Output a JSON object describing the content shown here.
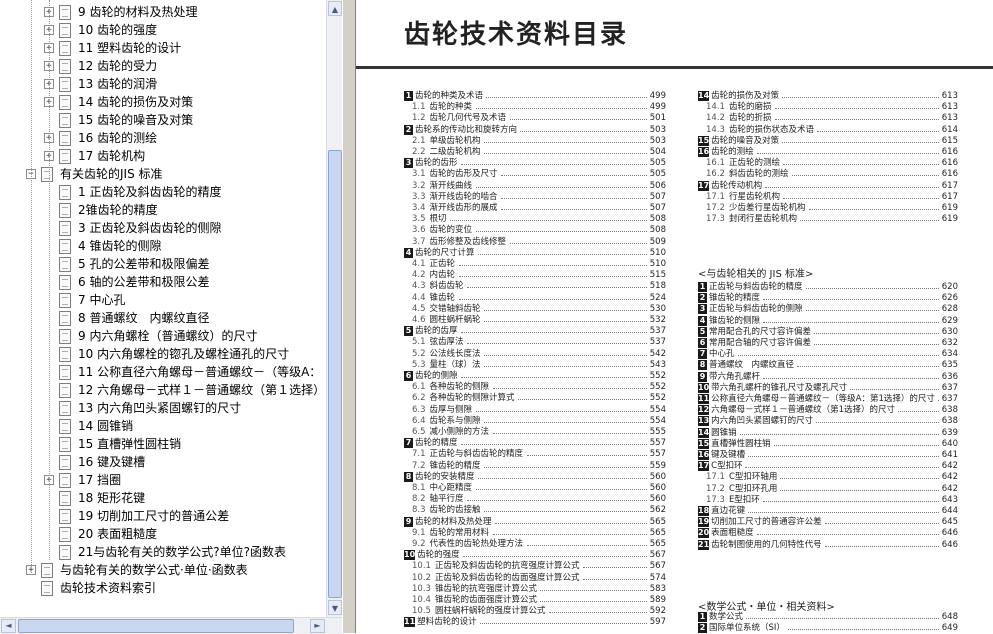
{
  "sidebar": {
    "tree": [
      {
        "indent": 1,
        "expander": "+",
        "label": "9 齿轮的材料及热处理"
      },
      {
        "indent": 1,
        "expander": "+",
        "label": "10 齿轮的强度"
      },
      {
        "indent": 1,
        "expander": "+",
        "label": "11 塑料齿轮的设计"
      },
      {
        "indent": 1,
        "expander": "+",
        "label": "12 齿轮的受力"
      },
      {
        "indent": 1,
        "expander": "+",
        "label": "13 齿轮的润滑"
      },
      {
        "indent": 1,
        "expander": "+",
        "label": "14 齿轮的损伤及对策"
      },
      {
        "indent": 1,
        "expander": "",
        "label": "15 齿轮的噪音及对策"
      },
      {
        "indent": 1,
        "expander": "+",
        "label": "16 齿轮的测绘"
      },
      {
        "indent": 1,
        "expander": "+",
        "label": "17 齿轮机构"
      },
      {
        "indent": 0,
        "expander": "−",
        "label": "有关齿轮的JIS 标准"
      },
      {
        "indent": 1,
        "expander": "",
        "label": "1 正齿轮及斜齿齿轮的精度"
      },
      {
        "indent": 1,
        "expander": "",
        "label": "2锥齿轮的精度"
      },
      {
        "indent": 1,
        "expander": "",
        "label": "3 正齿轮及斜齿齿轮的侧隙"
      },
      {
        "indent": 1,
        "expander": "",
        "label": "4 锥齿轮的侧隙"
      },
      {
        "indent": 1,
        "expander": "",
        "label": "5 孔的公差带和极限偏差"
      },
      {
        "indent": 1,
        "expander": "",
        "label": "6 轴的公差带和极限公差"
      },
      {
        "indent": 1,
        "expander": "",
        "label": "7 中心孔"
      },
      {
        "indent": 1,
        "expander": "",
        "label": "8 普通螺纹　内螺纹直径"
      },
      {
        "indent": 1,
        "expander": "",
        "label": "9 内六角螺栓（普通螺纹）的尺寸"
      },
      {
        "indent": 1,
        "expander": "",
        "label": "10 内六角螺栓的锪孔及螺栓通孔的尺寸"
      },
      {
        "indent": 1,
        "expander": "",
        "label": "11 公称直径六角螺母－普通螺纹－（等级A："
      },
      {
        "indent": 1,
        "expander": "",
        "label": "12 六角螺母－式样１－普通螺纹（第１选择）"
      },
      {
        "indent": 1,
        "expander": "",
        "label": "13 内六角凹头紧固螺钉的尺寸"
      },
      {
        "indent": 1,
        "expander": "",
        "label": "14 圆锥销"
      },
      {
        "indent": 1,
        "expander": "",
        "label": "15 直槽弹性圆柱销"
      },
      {
        "indent": 1,
        "expander": "",
        "label": "16 键及键槽"
      },
      {
        "indent": 1,
        "expander": "+",
        "label": "17 挡圈"
      },
      {
        "indent": 1,
        "expander": "",
        "label": "18 矩形花键"
      },
      {
        "indent": 1,
        "expander": "",
        "label": "19 切削加工尺寸的普通公差"
      },
      {
        "indent": 1,
        "expander": "",
        "label": "20 表面粗糙度"
      },
      {
        "indent": 1,
        "expander": "",
        "label": "21与齿轮有关的数学公式?单位?函数表"
      },
      {
        "indent": 0,
        "expander": "+",
        "label": "与齿轮有关的数学公式·单位·函数表"
      },
      {
        "indent": 0,
        "expander": "",
        "label": "齿轮技术资料索引"
      }
    ]
  },
  "scrollbars": {
    "up": "▲",
    "down": "▼",
    "left": "◄",
    "right": "►"
  },
  "document": {
    "title": "齿轮技术资料目录",
    "left_column": [
      {
        "type": "ch",
        "num": "1",
        "text": "齿轮的种类及术语",
        "page": "499"
      },
      {
        "type": "sub",
        "num": "1.1",
        "text": "齿轮的种类",
        "page": "499"
      },
      {
        "type": "sub",
        "num": "1.2",
        "text": "齿轮几何代号及术语",
        "page": "501"
      },
      {
        "type": "ch",
        "num": "2",
        "text": "齿轮系的传动比和旋转方向",
        "page": "503"
      },
      {
        "type": "sub",
        "num": "2.1",
        "text": "单级齿轮机构",
        "page": "503"
      },
      {
        "type": "sub",
        "num": "2.2",
        "text": "二级齿轮机构",
        "page": "504"
      },
      {
        "type": "ch",
        "num": "3",
        "text": "齿轮的齿形",
        "page": "505"
      },
      {
        "type": "sub",
        "num": "3.1",
        "text": "齿轮的齿形及尺寸",
        "page": "505"
      },
      {
        "type": "sub",
        "num": "3.2",
        "text": "渐开线曲线",
        "page": "506"
      },
      {
        "type": "sub",
        "num": "3.3",
        "text": "渐开线齿轮的啮合",
        "page": "507"
      },
      {
        "type": "sub",
        "num": "3.4",
        "text": "渐开线齿形的展成",
        "page": "507"
      },
      {
        "type": "sub",
        "num": "3.5",
        "text": "根切",
        "page": "508"
      },
      {
        "type": "sub",
        "num": "3.6",
        "text": "齿轮的变位",
        "page": "508"
      },
      {
        "type": "sub",
        "num": "3.7",
        "text": "齿形修整及齿线修整",
        "page": "509"
      },
      {
        "type": "ch",
        "num": "4",
        "text": "齿轮的尺寸计算",
        "page": "510"
      },
      {
        "type": "sub",
        "num": "4.1",
        "text": "正齿轮",
        "page": "510"
      },
      {
        "type": "sub",
        "num": "4.2",
        "text": "内齿轮",
        "page": "515"
      },
      {
        "type": "sub",
        "num": "4.3",
        "text": "斜齿齿轮",
        "page": "518"
      },
      {
        "type": "sub",
        "num": "4.4",
        "text": "锥齿轮",
        "page": "524"
      },
      {
        "type": "sub",
        "num": "4.5",
        "text": "交错轴斜齿轮",
        "page": "530"
      },
      {
        "type": "sub",
        "num": "4.6",
        "text": "圆柱蜗杆蜗轮",
        "page": "532"
      },
      {
        "type": "ch",
        "num": "5",
        "text": "齿轮的齿厚",
        "page": "537"
      },
      {
        "type": "sub",
        "num": "5.1",
        "text": "弦齿厚法",
        "page": "537"
      },
      {
        "type": "sub",
        "num": "5.2",
        "text": "公法线长度法",
        "page": "542"
      },
      {
        "type": "sub",
        "num": "5.3",
        "text": "量柱（球）法",
        "page": "543"
      },
      {
        "type": "ch",
        "num": "6",
        "text": "齿轮的侧隙",
        "page": "552"
      },
      {
        "type": "sub",
        "num": "6.1",
        "text": "各种齿轮的侧隙",
        "page": "552"
      },
      {
        "type": "sub",
        "num": "6.2",
        "text": "各种齿轮的侧隙计算式",
        "page": "552"
      },
      {
        "type": "sub",
        "num": "6.3",
        "text": "齿厚与侧隙",
        "page": "554"
      },
      {
        "type": "sub",
        "num": "6.4",
        "text": "齿轮系与侧隙",
        "page": "554"
      },
      {
        "type": "sub",
        "num": "6.5",
        "text": "减小侧隙的方法",
        "page": "555"
      },
      {
        "type": "ch",
        "num": "7",
        "text": "齿轮的精度",
        "page": "557"
      },
      {
        "type": "sub",
        "num": "7.1",
        "text": "正齿轮与斜齿齿轮的精度",
        "page": "557"
      },
      {
        "type": "sub",
        "num": "7.2",
        "text": "锥齿轮的精度",
        "page": "559"
      },
      {
        "type": "ch",
        "num": "8",
        "text": "齿轮的安装精度",
        "page": "560"
      },
      {
        "type": "sub",
        "num": "8.1",
        "text": "中心距精度",
        "page": "560"
      },
      {
        "type": "sub",
        "num": "8.2",
        "text": "轴平行度",
        "page": "560"
      },
      {
        "type": "sub",
        "num": "8.3",
        "text": "齿轮的齿接触",
        "page": "562"
      },
      {
        "type": "ch",
        "num": "9",
        "text": "齿轮的材料及热处理",
        "page": "565"
      },
      {
        "type": "sub",
        "num": "9.1",
        "text": "齿轮的常用材料",
        "page": "565"
      },
      {
        "type": "sub",
        "num": "9.2",
        "text": "代表性的齿轮热处理方法",
        "page": "565"
      },
      {
        "type": "ch",
        "num": "10",
        "text": "齿轮的强度",
        "page": "567"
      },
      {
        "type": "sub",
        "num": "10.1",
        "text": "正齿轮及斜齿齿轮的抗弯强度计算公式",
        "page": "567"
      },
      {
        "type": "sub",
        "num": "10.2",
        "text": "正齿轮及斜齿齿轮的齿面强度计算公式",
        "page": "574"
      },
      {
        "type": "sub",
        "num": "10.3",
        "text": "锥齿轮的抗弯强度计算公式",
        "page": "583"
      },
      {
        "type": "sub",
        "num": "10.4",
        "text": "锥齿轮的齿面强度计算公式",
        "page": "589"
      },
      {
        "type": "sub",
        "num": "10.5",
        "text": "圆柱蜗杆蜗轮的强度计算公式",
        "page": "592"
      },
      {
        "type": "ch",
        "num": "11",
        "text": "塑料齿轮的设计",
        "page": "597"
      }
    ],
    "right_column_top": [
      {
        "type": "ch",
        "num": "14",
        "text": "齿轮的损伤及对策",
        "page": "613"
      },
      {
        "type": "sub",
        "num": "14.1",
        "text": "齿轮的磨损",
        "page": "613"
      },
      {
        "type": "sub",
        "num": "14.2",
        "text": "齿轮的折损",
        "page": "613"
      },
      {
        "type": "sub",
        "num": "14.3",
        "text": "齿轮的损伤状态及术语",
        "page": "614"
      },
      {
        "type": "ch",
        "num": "15",
        "text": "齿轮的噪音及对策",
        "page": "615"
      },
      {
        "type": "ch",
        "num": "16",
        "text": "齿轮的测绘",
        "page": "616"
      },
      {
        "type": "sub",
        "num": "16.1",
        "text": "正齿轮的测绘",
        "page": "616"
      },
      {
        "type": "sub",
        "num": "16.2",
        "text": "斜齿齿轮的测绘",
        "page": "616"
      },
      {
        "type": "ch",
        "num": "17",
        "text": "齿轮传动机构",
        "page": "617"
      },
      {
        "type": "sub",
        "num": "17.1",
        "text": "行星齿轮机构",
        "page": "617"
      },
      {
        "type": "sub",
        "num": "17.2",
        "text": "少齿差行星齿轮机构",
        "page": "619"
      },
      {
        "type": "sub",
        "num": "17.3",
        "text": "封闭行星齿轮机构",
        "page": "619"
      }
    ],
    "jis_heading": "<与齿轮相关的 JIS 标准>",
    "jis_items": [
      {
        "type": "ch",
        "num": "1",
        "text": "正齿轮与斜齿齿轮的精度",
        "page": "620"
      },
      {
        "type": "ch",
        "num": "2",
        "text": "锥齿轮的精度",
        "page": "626"
      },
      {
        "type": "ch",
        "num": "3",
        "text": "正齿轮与斜齿齿轮的侧隙",
        "page": "628"
      },
      {
        "type": "ch",
        "num": "4",
        "text": "锥齿轮的侧隙",
        "page": "629"
      },
      {
        "type": "ch",
        "num": "5",
        "text": "常用配合孔的尺寸容许偏差",
        "page": "630"
      },
      {
        "type": "ch",
        "num": "6",
        "text": "常用配合轴的尺寸容许偏差",
        "page": "632"
      },
      {
        "type": "ch",
        "num": "7",
        "text": "中心孔",
        "page": "634"
      },
      {
        "type": "ch",
        "num": "8",
        "text": "普通螺纹　内螺纹直径",
        "page": "635"
      },
      {
        "type": "ch",
        "num": "9",
        "text": "带六角孔螺杆",
        "page": "636"
      },
      {
        "type": "ch",
        "num": "10",
        "text": "带六角孔螺杆的锥孔尺寸及螺孔尺寸",
        "page": "637"
      },
      {
        "type": "ch",
        "num": "11",
        "text": "公称直径六角螺母－普通螺纹－（等级A：第1选择）的尺寸",
        "page": "637"
      },
      {
        "type": "ch",
        "num": "12",
        "text": "六角螺母－式样１－普通螺纹（第1选择）的尺寸",
        "page": "638"
      },
      {
        "type": "ch",
        "num": "13",
        "text": "内六角凹头紧固螺钉的尺寸",
        "page": "638"
      },
      {
        "type": "ch",
        "num": "14",
        "text": "圆锥销",
        "page": "639"
      },
      {
        "type": "ch",
        "num": "15",
        "text": "直槽弹性圆柱销",
        "page": "640"
      },
      {
        "type": "ch",
        "num": "16",
        "text": "键及键槽",
        "page": "641"
      },
      {
        "type": "ch",
        "num": "17",
        "text": "C型扣环",
        "page": "642"
      },
      {
        "type": "sub",
        "num": "17.1",
        "text": "C型扣环轴用",
        "page": "642"
      },
      {
        "type": "sub",
        "num": "17.2",
        "text": "C型扣环孔用",
        "page": "642"
      },
      {
        "type": "sub",
        "num": "17.3",
        "text": "E型扣环",
        "page": "643"
      },
      {
        "type": "ch",
        "num": "18",
        "text": "直边花键",
        "page": "644"
      },
      {
        "type": "ch",
        "num": "19",
        "text": "切削加工尺寸的普通容许公差",
        "page": "645"
      },
      {
        "type": "ch",
        "num": "20",
        "text": "表面粗糙度",
        "page": "646"
      },
      {
        "type": "ch",
        "num": "21",
        "text": "齿轮制图使用的几何特性代号",
        "page": "646"
      }
    ],
    "math_heading": "<数学公式・单位・相关资料>",
    "math_items": [
      {
        "type": "ch",
        "num": "1",
        "text": "数学公式",
        "page": "648"
      },
      {
        "type": "ch",
        "num": "2",
        "text": "国际单位系统（SI）",
        "page": "649"
      }
    ]
  }
}
